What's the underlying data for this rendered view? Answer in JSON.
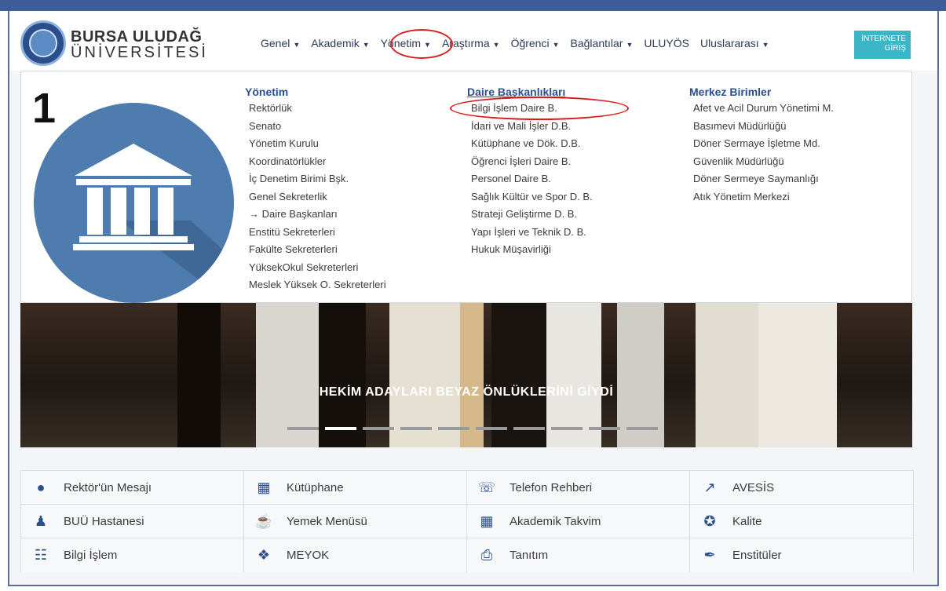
{
  "header": {
    "brand_line1": "BURSA ULUDAĞ",
    "brand_line2": "ÜNİVERSİTESİ",
    "nav": [
      {
        "label": "Genel",
        "caret": true
      },
      {
        "label": "Akademik",
        "caret": true
      },
      {
        "label": "Yönetim",
        "caret": true
      },
      {
        "label": "Araştırma",
        "caret": true
      },
      {
        "label": "Öğrenci",
        "caret": true
      },
      {
        "label": "Bağlantılar",
        "caret": true
      },
      {
        "label": "ULUYÖS",
        "caret": false
      },
      {
        "label": "Uluslararası",
        "caret": true
      }
    ],
    "login_line1": "İNTERNETE",
    "login_line2": "GİRİŞ"
  },
  "dropdown": {
    "step_number": "1",
    "col1": {
      "head": "Yönetim",
      "items": [
        "Rektörlük",
        "Senato",
        "Yönetim Kurulu",
        "Koordinatörlükler",
        "İç Denetim Birimi Bşk.",
        "Genel Sekreterlik",
        "→ Daire Başkanları",
        "Enstitü Sekreterleri",
        "Fakülte Sekreterleri",
        "YüksekOkul Sekreterleri",
        "Meslek Yüksek O. Sekreterleri"
      ]
    },
    "col2": {
      "head": "Daire Başkanlıkları",
      "items": [
        "Bilgi İşlem Daire B.",
        "İdari ve Mali İşler D.B.",
        "Kütüphane ve Dök. D.B.",
        "Öğrenci İşleri Daire B.",
        "Personel Daire B.",
        "Sağlık Kültür ve Spor D. B.",
        "Strateji Geliştirme D. B.",
        "Yapı İşleri ve Teknik D. B.",
        "Hukuk Müşavirliği"
      ]
    },
    "col3": {
      "head": "Merkez Birimler",
      "items": [
        "Afet ve Acil Durum Yönetimi M.",
        "Basımevi Müdürlüğü",
        "Döner Sermaye İşletme Md.",
        "Güvenlik Müdürlüğü",
        "Döner Sermeye Saymanlığı",
        "Atık Yönetim Merkezi"
      ]
    }
  },
  "hero": {
    "title": "HEKİM ADAYLARI BEYAZ ÖNLÜKLERİNİ GİYDİ",
    "slides": 10,
    "active_slide": 2
  },
  "quick_links": [
    {
      "label": "Rektör'ün Mesajı",
      "icon": "speech-bubble-icon"
    },
    {
      "label": "Kütüphane",
      "icon": "reader-icon"
    },
    {
      "label": "Telefon Rehberi",
      "icon": "phone-book-icon"
    },
    {
      "label": "AVESİS",
      "icon": "external-link-icon"
    },
    {
      "label": "BUÜ Hastanesi",
      "icon": "doctor-icon"
    },
    {
      "label": "Yemek Menüsü",
      "icon": "coffee-cup-icon"
    },
    {
      "label": "Akademik Takvim",
      "icon": "calendar-icon"
    },
    {
      "label": "Kalite",
      "icon": "award-icon"
    },
    {
      "label": "Bilgi İşlem",
      "icon": "network-icon"
    },
    {
      "label": "MEYOK",
      "icon": "branch-icon"
    },
    {
      "label": "Tanıtım",
      "icon": "pdf-file-icon"
    },
    {
      "label": "Enstitüler",
      "icon": "pen-icon"
    }
  ]
}
